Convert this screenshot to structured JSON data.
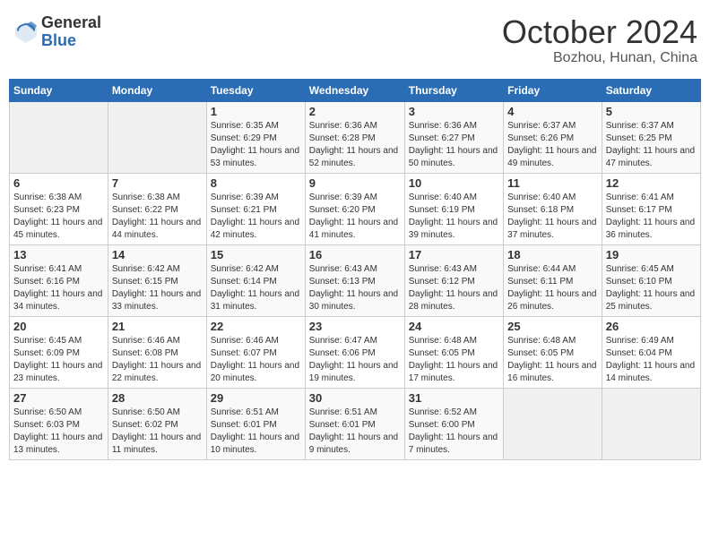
{
  "header": {
    "logo_general": "General",
    "logo_blue": "Blue",
    "month_title": "October 2024",
    "location": "Bozhou, Hunan, China"
  },
  "days_of_week": [
    "Sunday",
    "Monday",
    "Tuesday",
    "Wednesday",
    "Thursday",
    "Friday",
    "Saturday"
  ],
  "weeks": [
    [
      {
        "num": "",
        "empty": true
      },
      {
        "num": "",
        "empty": true
      },
      {
        "num": "1",
        "sunrise": "6:35 AM",
        "sunset": "6:29 PM",
        "daylight": "11 hours and 53 minutes."
      },
      {
        "num": "2",
        "sunrise": "6:36 AM",
        "sunset": "6:28 PM",
        "daylight": "11 hours and 52 minutes."
      },
      {
        "num": "3",
        "sunrise": "6:36 AM",
        "sunset": "6:27 PM",
        "daylight": "11 hours and 50 minutes."
      },
      {
        "num": "4",
        "sunrise": "6:37 AM",
        "sunset": "6:26 PM",
        "daylight": "11 hours and 49 minutes."
      },
      {
        "num": "5",
        "sunrise": "6:37 AM",
        "sunset": "6:25 PM",
        "daylight": "11 hours and 47 minutes."
      }
    ],
    [
      {
        "num": "6",
        "sunrise": "6:38 AM",
        "sunset": "6:23 PM",
        "daylight": "11 hours and 45 minutes."
      },
      {
        "num": "7",
        "sunrise": "6:38 AM",
        "sunset": "6:22 PM",
        "daylight": "11 hours and 44 minutes."
      },
      {
        "num": "8",
        "sunrise": "6:39 AM",
        "sunset": "6:21 PM",
        "daylight": "11 hours and 42 minutes."
      },
      {
        "num": "9",
        "sunrise": "6:39 AM",
        "sunset": "6:20 PM",
        "daylight": "11 hours and 41 minutes."
      },
      {
        "num": "10",
        "sunrise": "6:40 AM",
        "sunset": "6:19 PM",
        "daylight": "11 hours and 39 minutes."
      },
      {
        "num": "11",
        "sunrise": "6:40 AM",
        "sunset": "6:18 PM",
        "daylight": "11 hours and 37 minutes."
      },
      {
        "num": "12",
        "sunrise": "6:41 AM",
        "sunset": "6:17 PM",
        "daylight": "11 hours and 36 minutes."
      }
    ],
    [
      {
        "num": "13",
        "sunrise": "6:41 AM",
        "sunset": "6:16 PM",
        "daylight": "11 hours and 34 minutes."
      },
      {
        "num": "14",
        "sunrise": "6:42 AM",
        "sunset": "6:15 PM",
        "daylight": "11 hours and 33 minutes."
      },
      {
        "num": "15",
        "sunrise": "6:42 AM",
        "sunset": "6:14 PM",
        "daylight": "11 hours and 31 minutes."
      },
      {
        "num": "16",
        "sunrise": "6:43 AM",
        "sunset": "6:13 PM",
        "daylight": "11 hours and 30 minutes."
      },
      {
        "num": "17",
        "sunrise": "6:43 AM",
        "sunset": "6:12 PM",
        "daylight": "11 hours and 28 minutes."
      },
      {
        "num": "18",
        "sunrise": "6:44 AM",
        "sunset": "6:11 PM",
        "daylight": "11 hours and 26 minutes."
      },
      {
        "num": "19",
        "sunrise": "6:45 AM",
        "sunset": "6:10 PM",
        "daylight": "11 hours and 25 minutes."
      }
    ],
    [
      {
        "num": "20",
        "sunrise": "6:45 AM",
        "sunset": "6:09 PM",
        "daylight": "11 hours and 23 minutes."
      },
      {
        "num": "21",
        "sunrise": "6:46 AM",
        "sunset": "6:08 PM",
        "daylight": "11 hours and 22 minutes."
      },
      {
        "num": "22",
        "sunrise": "6:46 AM",
        "sunset": "6:07 PM",
        "daylight": "11 hours and 20 minutes."
      },
      {
        "num": "23",
        "sunrise": "6:47 AM",
        "sunset": "6:06 PM",
        "daylight": "11 hours and 19 minutes."
      },
      {
        "num": "24",
        "sunrise": "6:48 AM",
        "sunset": "6:05 PM",
        "daylight": "11 hours and 17 minutes."
      },
      {
        "num": "25",
        "sunrise": "6:48 AM",
        "sunset": "6:05 PM",
        "daylight": "11 hours and 16 minutes."
      },
      {
        "num": "26",
        "sunrise": "6:49 AM",
        "sunset": "6:04 PM",
        "daylight": "11 hours and 14 minutes."
      }
    ],
    [
      {
        "num": "27",
        "sunrise": "6:50 AM",
        "sunset": "6:03 PM",
        "daylight": "11 hours and 13 minutes."
      },
      {
        "num": "28",
        "sunrise": "6:50 AM",
        "sunset": "6:02 PM",
        "daylight": "11 hours and 11 minutes."
      },
      {
        "num": "29",
        "sunrise": "6:51 AM",
        "sunset": "6:01 PM",
        "daylight": "11 hours and 10 minutes."
      },
      {
        "num": "30",
        "sunrise": "6:51 AM",
        "sunset": "6:01 PM",
        "daylight": "11 hours and 9 minutes."
      },
      {
        "num": "31",
        "sunrise": "6:52 AM",
        "sunset": "6:00 PM",
        "daylight": "11 hours and 7 minutes."
      },
      {
        "num": "",
        "empty": true
      },
      {
        "num": "",
        "empty": true
      }
    ]
  ]
}
